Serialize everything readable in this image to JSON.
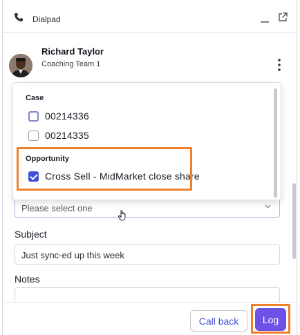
{
  "titlebar": {
    "title": "Dialpad",
    "icons": [
      "phone-icon",
      "minimize-icon",
      "popout-icon"
    ]
  },
  "contact": {
    "name": "Richard Taylor",
    "team": "Coaching Team 1"
  },
  "dropdown": {
    "groups": [
      {
        "label": "Case",
        "options": [
          {
            "label": "00214336",
            "checked": false
          },
          {
            "label": "00214335",
            "checked": false
          }
        ]
      },
      {
        "label": "Opportunity",
        "options": [
          {
            "label": "Cross Sell - MidMarket close share",
            "checked": true
          }
        ]
      }
    ]
  },
  "related_select": {
    "placeholder": "Please select one"
  },
  "subject": {
    "label": "Subject",
    "value": "Just sync-ed up this week"
  },
  "notes": {
    "label": "Notes",
    "value": ""
  },
  "footer": {
    "callback_label": "Call back",
    "log_label": "Log"
  },
  "colors": {
    "accent": "#3f4fd8",
    "log_button": "#6e52e6",
    "highlight": "#f07f2a"
  }
}
